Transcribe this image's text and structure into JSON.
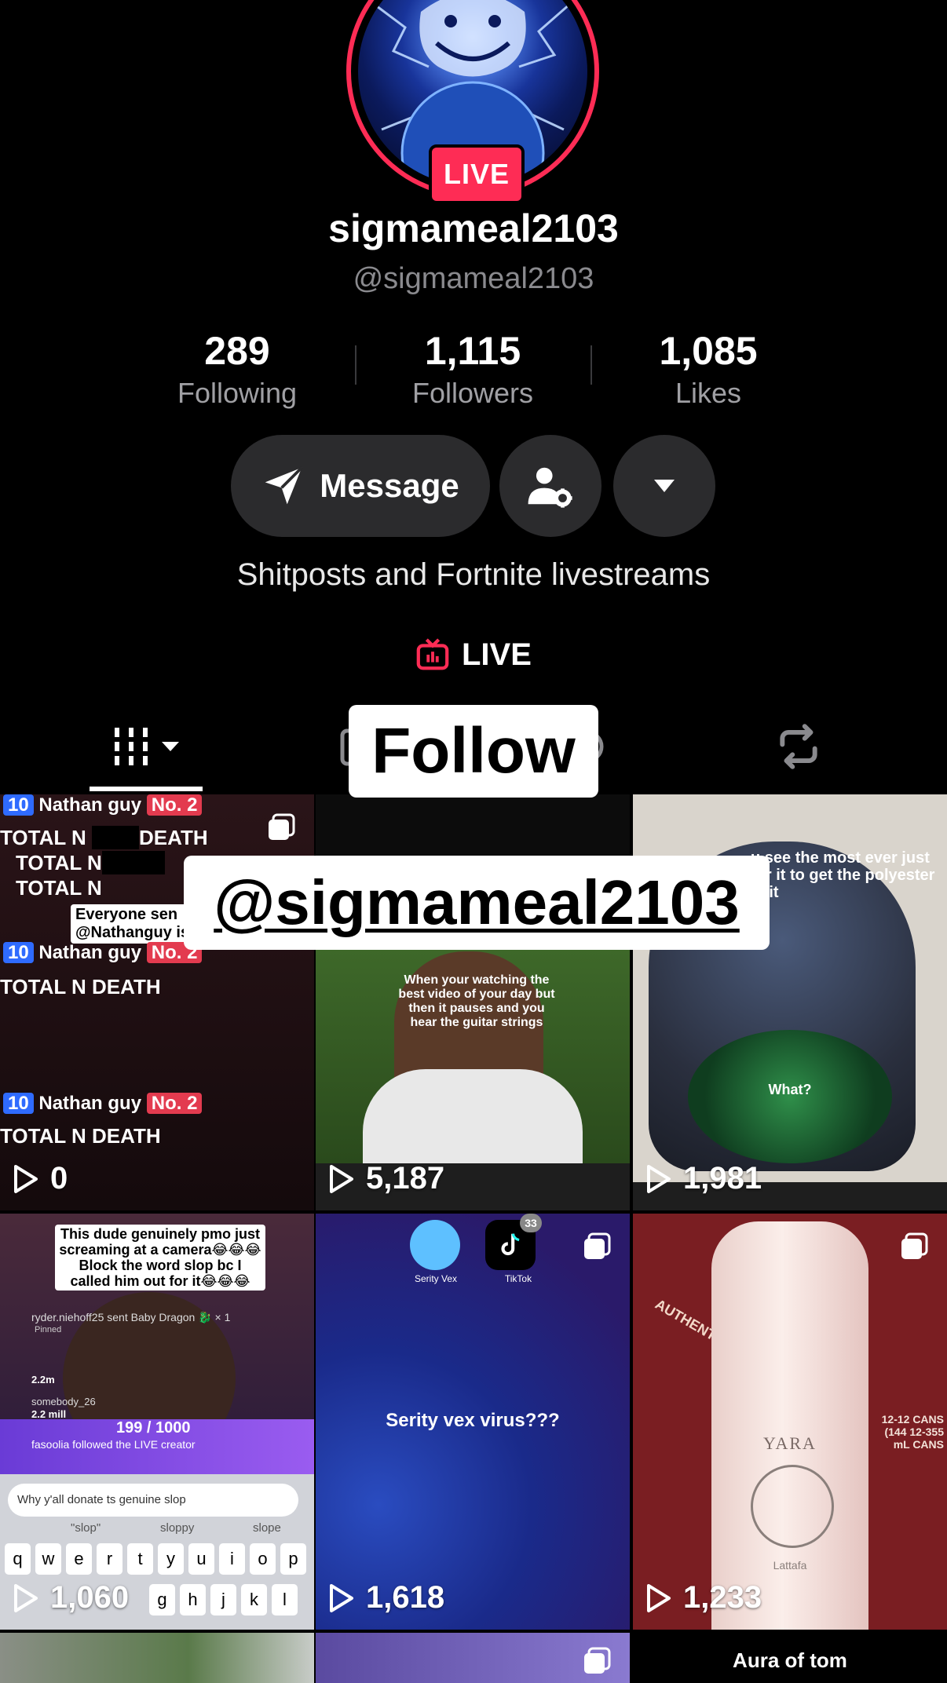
{
  "profile": {
    "live_badge": "LIVE",
    "display_name": "sigmameal2103",
    "handle": "@sigmameal2103",
    "bio": "Shitposts and Fortnite livestreams",
    "live_link": "LIVE"
  },
  "stats": [
    {
      "value": "289",
      "label": "Following"
    },
    {
      "value": "1,115",
      "label": "Followers"
    },
    {
      "value": "1,085",
      "label": "Likes"
    }
  ],
  "actions": {
    "message_label": "Message"
  },
  "overlays": {
    "follow_label": "Follow",
    "handle_label": "@sigmameal2103"
  },
  "videos": [
    {
      "views": "0",
      "texts": {
        "badge_rank": "10",
        "badge_name": "Nathan guy",
        "badge_no": "No. 2",
        "line_a": "TOTAL N",
        "line_b": "DEATH",
        "chat_a": "Everyone sen",
        "chat_b": "@Nathanguy is"
      }
    },
    {
      "views": "5,187",
      "caption": "When your watching the best video of your day but then it pauses and you hear the guitar strings"
    },
    {
      "views": "1,981",
      "caption_top": "u see the most ever just for it to get the polyester edit",
      "caption_mid": "What?"
    },
    {
      "views": "1,060",
      "caption": "This dude genuinely pmo just screaming at a camera😂😂😂 Block the word slop bc I called him out for it😂😂😂",
      "gift": "ryder.niehoff25 sent Baby Dragon 🐉 × 1",
      "pinned": "Pinned",
      "viewers_a": "2.2m",
      "user_b": "somebody_26",
      "viewers_b": "2.2 mill",
      "progress": "199 / 1000",
      "followed": "fasoolia followed the LIVE creator",
      "input": "Why y'all donate ts genuine slop",
      "suggest": [
        "\"slop\"",
        "sloppy",
        "slope"
      ],
      "keys": [
        "q",
        "w",
        "e",
        "r",
        "t",
        "y",
        "u",
        "i",
        "o",
        "p"
      ],
      "keys2": [
        "g",
        "h",
        "j",
        "k",
        "l"
      ]
    },
    {
      "views": "1,618",
      "app_a": "Serity Vex",
      "app_b": "TikTok",
      "notif": "33",
      "caption": "Serity vex virus???"
    },
    {
      "views": "1,233",
      "brand": "YARA",
      "maker": "Lattafa",
      "box_text": "AUTHENTIC BLE",
      "box_cans": "12-12 CANS (144 12-355 mL CANS"
    },
    {
      "views": "",
      "caption": ""
    },
    {
      "views": "",
      "caption": ""
    },
    {
      "views": "",
      "caption": "Aura of tom"
    }
  ],
  "colors": {
    "accent": "#fe2c55",
    "background": "#000000",
    "button": "#2b2b2d",
    "muted": "#8a8a8e"
  }
}
